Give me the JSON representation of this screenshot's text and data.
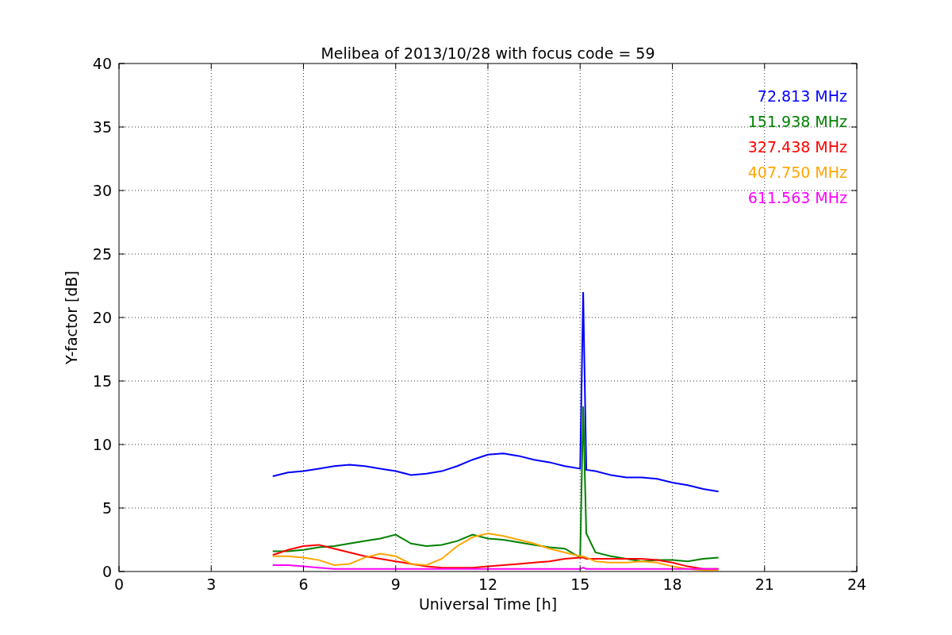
{
  "chart_data": {
    "type": "line",
    "title": "Melibea of 2013/10/28 with focus code = 59",
    "xlabel": "Universal Time [h]",
    "ylabel": "Y-factor [dB]",
    "x": [
      5,
      5.5,
      6,
      6.5,
      7,
      7.5,
      8,
      8.5,
      9,
      9.5,
      10,
      10.5,
      11,
      11.5,
      12,
      12.5,
      13,
      13.5,
      14,
      14.5,
      15,
      15.1,
      15.2,
      15.5,
      16,
      16.5,
      17,
      17.5,
      18,
      18.5,
      19,
      19.5
    ],
    "series": [
      {
        "name": "72.813 MHz",
        "color": "#0000ff",
        "values": [
          7.5,
          7.8,
          7.9,
          8.1,
          8.3,
          8.4,
          8.3,
          8.1,
          7.9,
          7.6,
          7.7,
          7.9,
          8.3,
          8.8,
          9.2,
          9.3,
          9.1,
          8.8,
          8.6,
          8.3,
          8.1,
          22,
          8,
          7.9,
          7.6,
          7.4,
          7.4,
          7.3,
          7.0,
          6.8,
          6.5,
          6.3
        ]
      },
      {
        "name": "151.938 MHz",
        "color": "#008000",
        "values": [
          1.6,
          1.6,
          1.7,
          1.9,
          2.0,
          2.2,
          2.4,
          2.6,
          2.9,
          2.2,
          2.0,
          2.1,
          2.4,
          2.9,
          2.6,
          2.5,
          2.3,
          2.1,
          1.9,
          1.8,
          1.1,
          13,
          3,
          1.5,
          1.2,
          1.0,
          0.8,
          0.9,
          0.9,
          0.8,
          1.0,
          1.1
        ]
      },
      {
        "name": "327.438 MHz",
        "color": "#ff0000",
        "values": [
          1.3,
          1.7,
          2.0,
          2.1,
          1.8,
          1.5,
          1.2,
          1.0,
          0.8,
          0.6,
          0.4,
          0.3,
          0.3,
          0.3,
          0.4,
          0.5,
          0.6,
          0.7,
          0.8,
          1.0,
          1.1,
          1.1,
          1.0,
          1.0,
          1.0,
          1.0,
          1.0,
          0.9,
          0.7,
          0.4,
          0.2,
          0.2
        ]
      },
      {
        "name": "407.750 MHz",
        "color": "#ffa500",
        "values": [
          1.2,
          1.2,
          1.1,
          0.9,
          0.5,
          0.6,
          1.1,
          1.4,
          1.2,
          0.6,
          0.5,
          1.0,
          2.0,
          2.7,
          3.0,
          2.8,
          2.5,
          2.2,
          1.8,
          1.5,
          1.2,
          1.2,
          1.1,
          0.8,
          0.7,
          0.7,
          0.8,
          0.7,
          0.4,
          0.2,
          0.1,
          0.1
        ]
      },
      {
        "name": "611.563 MHz",
        "color": "#ff00ff",
        "values": [
          0.5,
          0.5,
          0.4,
          0.3,
          0.2,
          0.2,
          0.2,
          0.2,
          0.2,
          0.2,
          0.2,
          0.2,
          0.2,
          0.2,
          0.2,
          0.2,
          0.2,
          0.2,
          0.2,
          0.2,
          0.2,
          0.3,
          0.2,
          0.2,
          0.2,
          0.2,
          0.2,
          0.2,
          0.2,
          0.2,
          0.2,
          0.2
        ]
      }
    ],
    "grid": true,
    "xlim": [
      0,
      24
    ],
    "ylim": [
      0,
      40
    ],
    "xticks": [
      0,
      3,
      6,
      9,
      12,
      15,
      18,
      21,
      24
    ],
    "yticks": [
      0,
      5,
      10,
      15,
      20,
      25,
      30,
      35,
      40
    ]
  }
}
